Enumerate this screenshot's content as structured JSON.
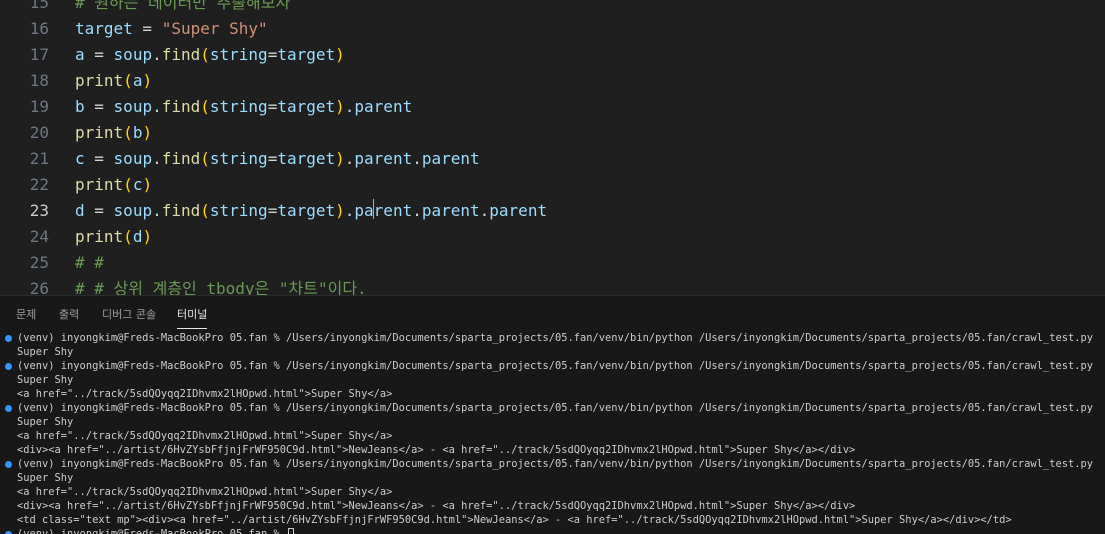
{
  "editor": {
    "active_line": "23",
    "lines": [
      {
        "num": "15",
        "tokens": [
          {
            "t": "# 원하는 데이터만 추출해보자",
            "c": "cm"
          }
        ]
      },
      {
        "num": "16",
        "tokens": [
          {
            "t": "target",
            "c": "var"
          },
          {
            "t": " = ",
            "c": "op"
          },
          {
            "t": "\"Super Shy\"",
            "c": "str"
          }
        ]
      },
      {
        "num": "17",
        "tokens": [
          {
            "t": "a",
            "c": "var"
          },
          {
            "t": " = ",
            "c": "op"
          },
          {
            "t": "soup",
            "c": "var"
          },
          {
            "t": ".",
            "c": "op"
          },
          {
            "t": "find",
            "c": "fn"
          },
          {
            "t": "(",
            "c": "br"
          },
          {
            "t": "string",
            "c": "var"
          },
          {
            "t": "=",
            "c": "op"
          },
          {
            "t": "target",
            "c": "var"
          },
          {
            "t": ")",
            "c": "br"
          }
        ]
      },
      {
        "num": "18",
        "tokens": [
          {
            "t": "print",
            "c": "fn"
          },
          {
            "t": "(",
            "c": "br"
          },
          {
            "t": "a",
            "c": "var"
          },
          {
            "t": ")",
            "c": "br"
          }
        ]
      },
      {
        "num": "19",
        "tokens": [
          {
            "t": "b",
            "c": "var"
          },
          {
            "t": " = ",
            "c": "op"
          },
          {
            "t": "soup",
            "c": "var"
          },
          {
            "t": ".",
            "c": "op"
          },
          {
            "t": "find",
            "c": "fn"
          },
          {
            "t": "(",
            "c": "br"
          },
          {
            "t": "string",
            "c": "var"
          },
          {
            "t": "=",
            "c": "op"
          },
          {
            "t": "target",
            "c": "var"
          },
          {
            "t": ")",
            "c": "br"
          },
          {
            "t": ".",
            "c": "op"
          },
          {
            "t": "parent",
            "c": "var"
          }
        ]
      },
      {
        "num": "20",
        "tokens": [
          {
            "t": "print",
            "c": "fn"
          },
          {
            "t": "(",
            "c": "br"
          },
          {
            "t": "b",
            "c": "var"
          },
          {
            "t": ")",
            "c": "br"
          }
        ]
      },
      {
        "num": "21",
        "tokens": [
          {
            "t": "c",
            "c": "var"
          },
          {
            "t": " = ",
            "c": "op"
          },
          {
            "t": "soup",
            "c": "var"
          },
          {
            "t": ".",
            "c": "op"
          },
          {
            "t": "find",
            "c": "fn"
          },
          {
            "t": "(",
            "c": "br"
          },
          {
            "t": "string",
            "c": "var"
          },
          {
            "t": "=",
            "c": "op"
          },
          {
            "t": "target",
            "c": "var"
          },
          {
            "t": ")",
            "c": "br"
          },
          {
            "t": ".",
            "c": "op"
          },
          {
            "t": "parent",
            "c": "var"
          },
          {
            "t": ".",
            "c": "op"
          },
          {
            "t": "parent",
            "c": "var"
          }
        ]
      },
      {
        "num": "22",
        "tokens": [
          {
            "t": "print",
            "c": "fn"
          },
          {
            "t": "(",
            "c": "br"
          },
          {
            "t": "c",
            "c": "var"
          },
          {
            "t": ")",
            "c": "br"
          }
        ]
      },
      {
        "num": "23",
        "tokens": [
          {
            "t": "d",
            "c": "var"
          },
          {
            "t": " = ",
            "c": "op"
          },
          {
            "t": "soup",
            "c": "var"
          },
          {
            "t": ".",
            "c": "op"
          },
          {
            "t": "find",
            "c": "fn"
          },
          {
            "t": "(",
            "c": "br"
          },
          {
            "t": "string",
            "c": "var"
          },
          {
            "t": "=",
            "c": "op"
          },
          {
            "t": "target",
            "c": "var"
          },
          {
            "t": ")",
            "c": "br"
          },
          {
            "t": ".",
            "c": "op"
          },
          {
            "t": "pa",
            "c": "var"
          },
          {
            "caret": true
          },
          {
            "t": "rent",
            "c": "var"
          },
          {
            "t": ".",
            "c": "op"
          },
          {
            "t": "parent",
            "c": "var"
          },
          {
            "t": ".",
            "c": "op"
          },
          {
            "t": "parent",
            "c": "var"
          }
        ]
      },
      {
        "num": "24",
        "tokens": [
          {
            "t": "print",
            "c": "fn"
          },
          {
            "t": "(",
            "c": "br"
          },
          {
            "t": "d",
            "c": "var"
          },
          {
            "t": ")",
            "c": "br"
          }
        ]
      },
      {
        "num": "25",
        "tokens": [
          {
            "t": "# #",
            "c": "cm"
          }
        ]
      },
      {
        "num": "26",
        "tokens": [
          {
            "t": "# # 상위 계층인 tbody은 \"차트\"이다.",
            "c": "cm"
          }
        ]
      }
    ]
  },
  "panel": {
    "tabs": [
      {
        "label": "문제",
        "active": false
      },
      {
        "label": "출력",
        "active": false
      },
      {
        "label": "디버그 콘솔",
        "active": false
      },
      {
        "label": "터미널",
        "active": true
      }
    ]
  },
  "terminal": {
    "lines": [
      {
        "text": "(venv) inyongkim@Freds-MacBookPro 05.fan % /Users/inyongkim/Documents/sparta_projects/05.fan/venv/bin/python /Users/inyongkim/Documents/sparta_projects/05.fan/crawl_test.py",
        "dot": true
      },
      {
        "text": "Super Shy",
        "dot": false
      },
      {
        "text": "(venv) inyongkim@Freds-MacBookPro 05.fan % /Users/inyongkim/Documents/sparta_projects/05.fan/venv/bin/python /Users/inyongkim/Documents/sparta_projects/05.fan/crawl_test.py",
        "dot": true
      },
      {
        "text": "Super Shy",
        "dot": false
      },
      {
        "text": "<a href=\"../track/5sdQOyqq2IDhvmx2lHOpwd.html\">Super Shy</a>",
        "dot": false
      },
      {
        "text": "(venv) inyongkim@Freds-MacBookPro 05.fan % /Users/inyongkim/Documents/sparta_projects/05.fan/venv/bin/python /Users/inyongkim/Documents/sparta_projects/05.fan/crawl_test.py",
        "dot": true
      },
      {
        "text": "Super Shy",
        "dot": false
      },
      {
        "text": "<a href=\"../track/5sdQOyqq2IDhvmx2lHOpwd.html\">Super Shy</a>",
        "dot": false
      },
      {
        "text": "<div><a href=\"../artist/6HvZYsbFfjnjFrWF950C9d.html\">NewJeans</a> - <a href=\"../track/5sdQOyqq2IDhvmx2lHOpwd.html\">Super Shy</a></div>",
        "dot": false
      },
      {
        "text": "(venv) inyongkim@Freds-MacBookPro 05.fan % /Users/inyongkim/Documents/sparta_projects/05.fan/venv/bin/python /Users/inyongkim/Documents/sparta_projects/05.fan/crawl_test.py",
        "dot": true
      },
      {
        "text": "Super Shy",
        "dot": false
      },
      {
        "text": "<a href=\"../track/5sdQOyqq2IDhvmx2lHOpwd.html\">Super Shy</a>",
        "dot": false
      },
      {
        "text": "<div><a href=\"../artist/6HvZYsbFfjnjFrWF950C9d.html\">NewJeans</a> - <a href=\"../track/5sdQOyqq2IDhvmx2lHOpwd.html\">Super Shy</a></div>",
        "dot": false
      },
      {
        "text": "<td class=\"text mp\"><div><a href=\"../artist/6HvZYsbFfjnjFrWF950C9d.html\">NewJeans</a> - <a href=\"../track/5sdQOyqq2IDhvmx2lHOpwd.html\">Super Shy</a></div></td>",
        "dot": false
      },
      {
        "text": "(venv) inyongkim@Freds-MacBookPro 05.fan % ",
        "dot": true,
        "cursor": true
      }
    ]
  }
}
